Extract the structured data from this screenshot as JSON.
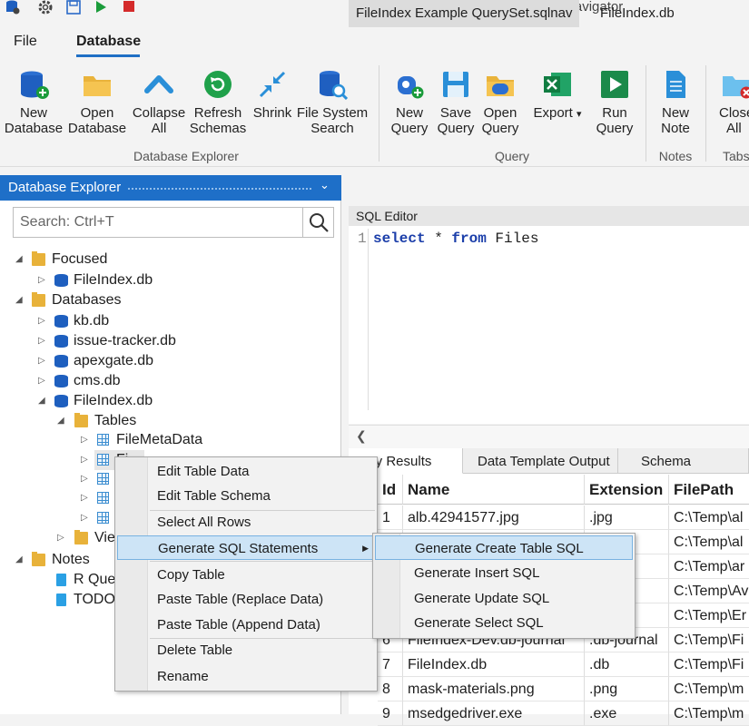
{
  "app_title": "SQLite Navigator",
  "menu": {
    "file": "File",
    "database": "Database"
  },
  "ribbon": {
    "buttons": [
      {
        "line1": "New",
        "line2": "Database"
      },
      {
        "line1": "Open",
        "line2": "Database"
      },
      {
        "line1": "Collapse",
        "line2": "All"
      },
      {
        "line1": "Refresh",
        "line2": "Schemas"
      },
      {
        "line1": "Shrink",
        "line2": ""
      },
      {
        "line1": "File System",
        "line2": "Search"
      },
      {
        "line1": "New",
        "line2": "Query"
      },
      {
        "line1": "Save",
        "line2": "Query"
      },
      {
        "line1": "Open",
        "line2": "Query"
      },
      {
        "line1": "Export",
        "line2": ""
      },
      {
        "line1": "Run",
        "line2": "Query"
      },
      {
        "line1": "New",
        "line2": "Note"
      },
      {
        "line1": "Close",
        "line2": "All"
      }
    ],
    "groups": [
      "Database Explorer",
      "Query",
      "Notes",
      "Tabs"
    ],
    "export_caret": "▾"
  },
  "explorer": {
    "title": "Database Explorer",
    "search_placeholder": "Search: Ctrl+T",
    "tree": {
      "focused": "Focused",
      "focused_db": "FileIndex.db",
      "databases": "Databases",
      "dbs": [
        "kb.db",
        "issue-tracker.db",
        "apexgate.db",
        "cms.db",
        "FileIndex.db"
      ],
      "tables": "Tables",
      "table_first": "FileMetaData",
      "table_partial": "Fi",
      "views": "Vie",
      "notes": "Notes",
      "note1": "R Que",
      "note2": "TODO"
    }
  },
  "tabs": [
    "FileIndex Example QuerySet.sqlnav",
    "FileIndex.db"
  ],
  "editor": {
    "header": "SQL Editor",
    "line_no": "1",
    "kw1": "select",
    "star": " * ",
    "kw2": "from",
    "rest": " Files"
  },
  "result_tabs": [
    "uery Results",
    "Data Template Output",
    "Schema Template"
  ],
  "grid": {
    "columns": [
      "Id",
      "Name",
      "Extension",
      "FilePath"
    ],
    "rows": [
      [
        "1",
        "alb.42941577.jpg",
        ".jpg",
        "C:\\Temp\\al"
      ],
      [
        "",
        "",
        "",
        "C:\\Temp\\al"
      ],
      [
        "",
        "",
        "",
        "C:\\Temp\\ar"
      ],
      [
        "",
        "",
        "",
        "C:\\Temp\\Av"
      ],
      [
        "",
        "",
        "",
        "C:\\Temp\\Er"
      ],
      [
        "6",
        "FileIndex-Dev.db-journal",
        ".db-journal",
        "C:\\Temp\\Fi"
      ],
      [
        "7",
        "FileIndex.db",
        ".db",
        "C:\\Temp\\Fi"
      ],
      [
        "8",
        "mask-materials.png",
        ".png",
        "C:\\Temp\\m"
      ],
      [
        "9",
        "msedgedriver.exe",
        ".exe",
        "C:\\Temp\\m"
      ]
    ]
  },
  "context_menu": {
    "items": [
      "Edit Table Data",
      "Edit Table Schema",
      "Select All Rows",
      "Generate SQL Statements",
      "Copy Table",
      "Paste Table (Replace Data)",
      "Paste Table (Append Data)",
      "Delete Table",
      "Rename"
    ],
    "submenu_arrow": "▶"
  },
  "submenu": {
    "items": [
      "Generate Create Table SQL",
      "Generate Insert SQL",
      "Generate Update SQL",
      "Generate Select SQL"
    ]
  }
}
